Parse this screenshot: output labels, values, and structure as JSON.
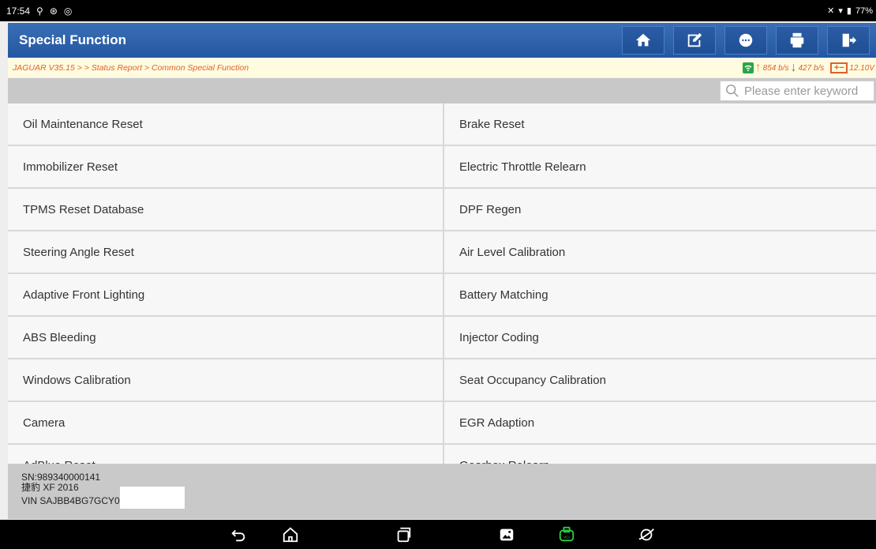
{
  "status_bar": {
    "time": "17:54",
    "battery": "77%"
  },
  "header": {
    "title": "Special Function",
    "buttons": [
      {
        "name": "home-icon"
      },
      {
        "name": "edit-report-icon"
      },
      {
        "name": "chat-icon"
      },
      {
        "name": "print-icon"
      },
      {
        "name": "exit-icon"
      }
    ]
  },
  "breadcrumb": "JAGUAR V35.15 > > Status Report > Common Special Function",
  "vci_status": {
    "upload": "854 b/s",
    "download": "427 b/s",
    "battery_label": "+−",
    "voltage": "12.10V"
  },
  "search": {
    "placeholder": "Please enter keyword"
  },
  "functions": [
    {
      "left": "Oil Maintenance Reset",
      "right": "Brake Reset"
    },
    {
      "left": "Immobilizer Reset",
      "right": "Electric Throttle Relearn"
    },
    {
      "left": "TPMS Reset Database",
      "right": "DPF Regen"
    },
    {
      "left": "Steering Angle Reset",
      "right": "Air Level Calibration"
    },
    {
      "left": "Adaptive Front Lighting",
      "right": "Battery Matching"
    },
    {
      "left": "ABS Bleeding",
      "right": "Injector Coding"
    },
    {
      "left": "Windows Calibration",
      "right": "Seat Occupancy Calibration"
    },
    {
      "left": "Camera",
      "right": "EGR Adaption"
    },
    {
      "left": "AdBlue Reset",
      "right": "Gearbox Relearn"
    }
  ],
  "vehicle_info": {
    "sn": "SN:989340000141",
    "model": "捷豹 XF 2016",
    "vin": "VIN SAJBB4BG7GCY0"
  },
  "colors": {
    "header_blue": "#2a5da6",
    "crumb_orange": "#e0612a",
    "vci_green": "#27a646"
  }
}
